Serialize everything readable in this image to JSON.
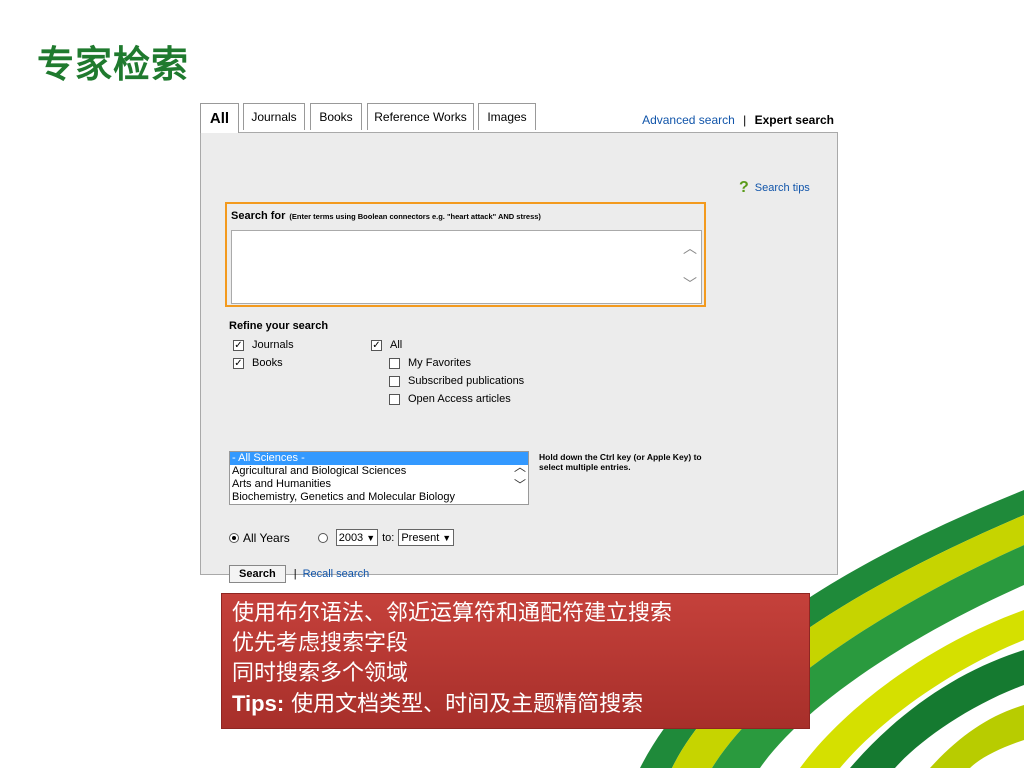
{
  "slide": {
    "title": "专家检索"
  },
  "tabs": [
    {
      "label": "All",
      "active": true
    },
    {
      "label": "Journals"
    },
    {
      "label": "Books"
    },
    {
      "label": "Reference Works"
    },
    {
      "label": "Images"
    }
  ],
  "top_links": {
    "advanced": "Advanced search",
    "separator": "|",
    "expert": "Expert search"
  },
  "search_tips": {
    "icon": "question-mark-icon",
    "label": "Search tips"
  },
  "search_for": {
    "label": "Search for",
    "hint": "(Enter terms using Boolean connectors e.g. \"heart attack\" AND stress)",
    "value": ""
  },
  "refine": {
    "title": "Refine your search",
    "content_types": [
      {
        "label": "Journals",
        "checked": true
      },
      {
        "label": "Books",
        "checked": true
      }
    ],
    "access": [
      {
        "label": "All",
        "checked": true
      },
      {
        "label": "My Favorites",
        "checked": false
      },
      {
        "label": "Subscribed publications",
        "checked": false
      },
      {
        "label": "Open Access articles",
        "checked": false
      }
    ]
  },
  "subjects": {
    "options": [
      "- All Sciences -",
      "Agricultural and Biological Sciences",
      "Arts and Humanities",
      "Biochemistry, Genetics and Molecular Biology"
    ],
    "selected": 0,
    "note": "Hold down the Ctrl key (or Apple Key) to select multiple entries."
  },
  "years": {
    "all_label": "All Years",
    "all_selected": true,
    "from": "2003",
    "to_label": "to:",
    "to": "Present"
  },
  "buttons": {
    "search": "Search",
    "separator": "|",
    "recall": "Recall search"
  },
  "caption": {
    "lines": [
      "使用布尔语法、邻近运算符和通配符建立搜索",
      "优先考虑搜索字段",
      "同时搜索多个领域"
    ],
    "tips_label": "Tips:",
    "tips_text": " 使用文档类型、时间及主题精简搜索"
  },
  "colors": {
    "title_green": "#1f7a2e",
    "search_border": "#f39a1e",
    "link": "#1155aa",
    "caption_bg": "#b7372f"
  }
}
